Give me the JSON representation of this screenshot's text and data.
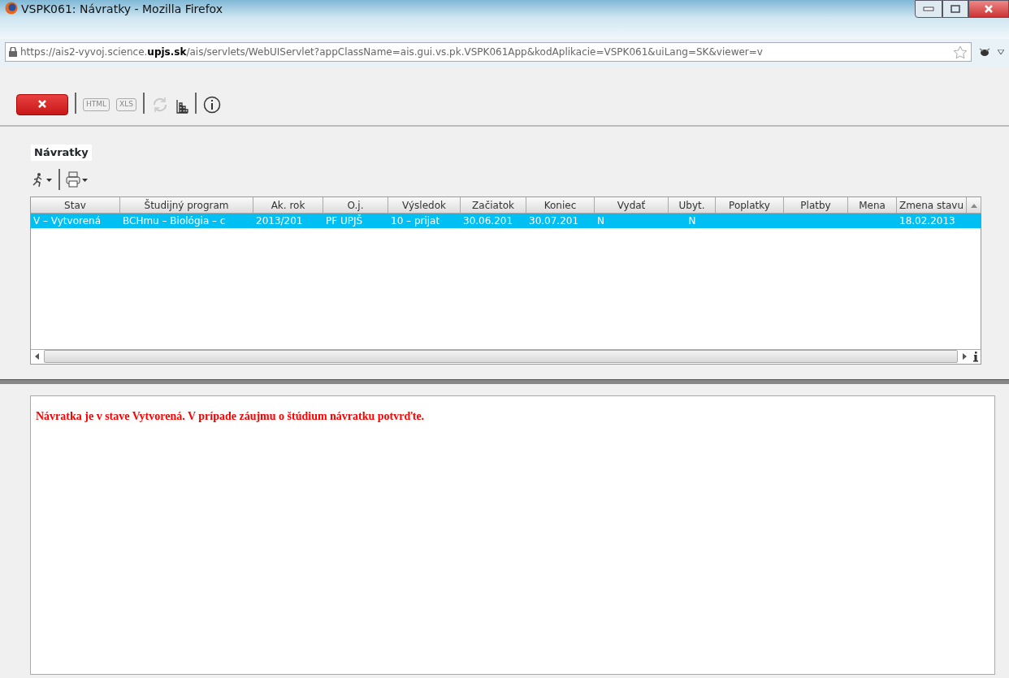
{
  "window": {
    "title": "VSPK061: Návratky - Mozilla Firefox"
  },
  "address_bar": {
    "url": "https://ais2-vyvoj.science.**upjs.sk**/ais/servlets/WebUIServlet?appClassName=ais.gui.vs.pk.VSPK061App&kodAplikacie=VSPK061&uiLang=SK&viewer=v"
  },
  "toolbar": [
    {
      "kind": "close",
      "disabled": false
    },
    {
      "kind": "text",
      "label": "HTML",
      "disabled": true
    },
    {
      "kind": "text",
      "label": "XLS",
      "disabled": true
    },
    {
      "kind": "refresh",
      "disabled": true
    },
    {
      "kind": "columns",
      "disabled": false
    },
    {
      "kind": "info",
      "disabled": false
    }
  ],
  "panel": {
    "title": "Návratky"
  },
  "table": {
    "columns": [
      "Stav",
      "Študijný program",
      "Ak. rok",
      "O.j.",
      "Výsledok",
      "Začiatok",
      "Koniec",
      "Vydať",
      "Ubyt.",
      "Poplatky",
      "Platby",
      "Mena",
      "Zmena stavu"
    ],
    "rows": [
      {
        "selected": true,
        "cells": [
          "V – Vytvorená",
          "BCHmu – Biológia – c",
          "2013/201",
          "PF UPJŠ",
          "10 – prijat",
          "30.06.201",
          "30.07.201",
          "N",
          "N",
          "",
          "",
          "",
          "18.02.2013"
        ]
      }
    ]
  },
  "message": "Návratka je v stave Vytvorená. V prípade záujmu o štúdium návratku potvrďte."
}
